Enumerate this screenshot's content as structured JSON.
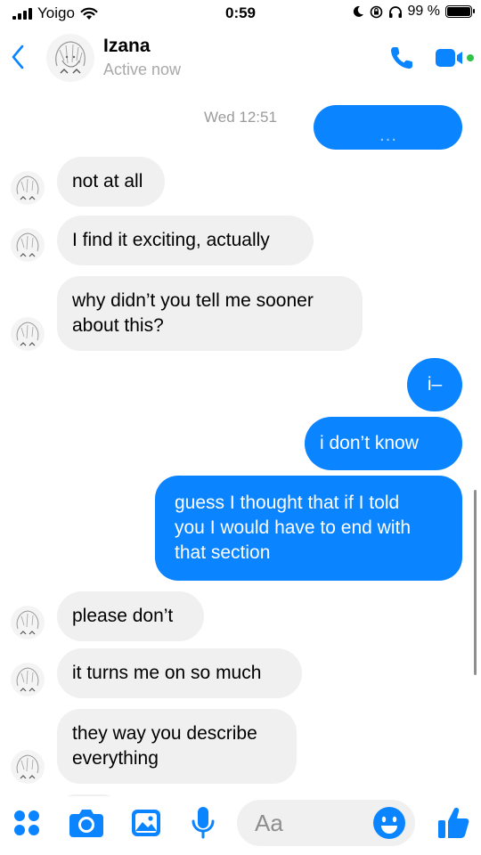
{
  "status_bar": {
    "carrier": "Yoigo",
    "time": "0:59",
    "battery_text": "99 %",
    "battery_level": 0.99
  },
  "header": {
    "name": "Izana",
    "status": "Active now",
    "icons": [
      "back-chevron-icon",
      "phone-icon",
      "video-camera-icon"
    ]
  },
  "chat": {
    "timestamp": "Wed 12:51",
    "messages": [
      {
        "from": "me",
        "text": "…"
      },
      {
        "from": "them",
        "text": "not at all"
      },
      {
        "from": "them",
        "text": "I find it exciting, actually"
      },
      {
        "from": "them",
        "text": "why didn’t you tell me sooner\nabout this?"
      },
      {
        "from": "me",
        "text": "i–"
      },
      {
        "from": "me",
        "text": "i don’t know"
      },
      {
        "from": "me",
        "text": "guess I thought that if I told\nyou I would have to end with\nthat section"
      },
      {
        "from": "them",
        "text": "please don’t"
      },
      {
        "from": "them",
        "text": "it turns me on so much"
      },
      {
        "from": "them",
        "text": "they way you describe\neverything"
      }
    ]
  },
  "composer": {
    "placeholder": "Aa",
    "icons": [
      "apps-grid-icon",
      "camera-icon",
      "gallery-icon",
      "microphone-icon",
      "emoji-icon",
      "thumbs-up-icon"
    ]
  },
  "colors": {
    "accent": "#0a84ff",
    "incoming_bubble": "#f0f0f0",
    "muted_text": "#a9a9a9"
  }
}
